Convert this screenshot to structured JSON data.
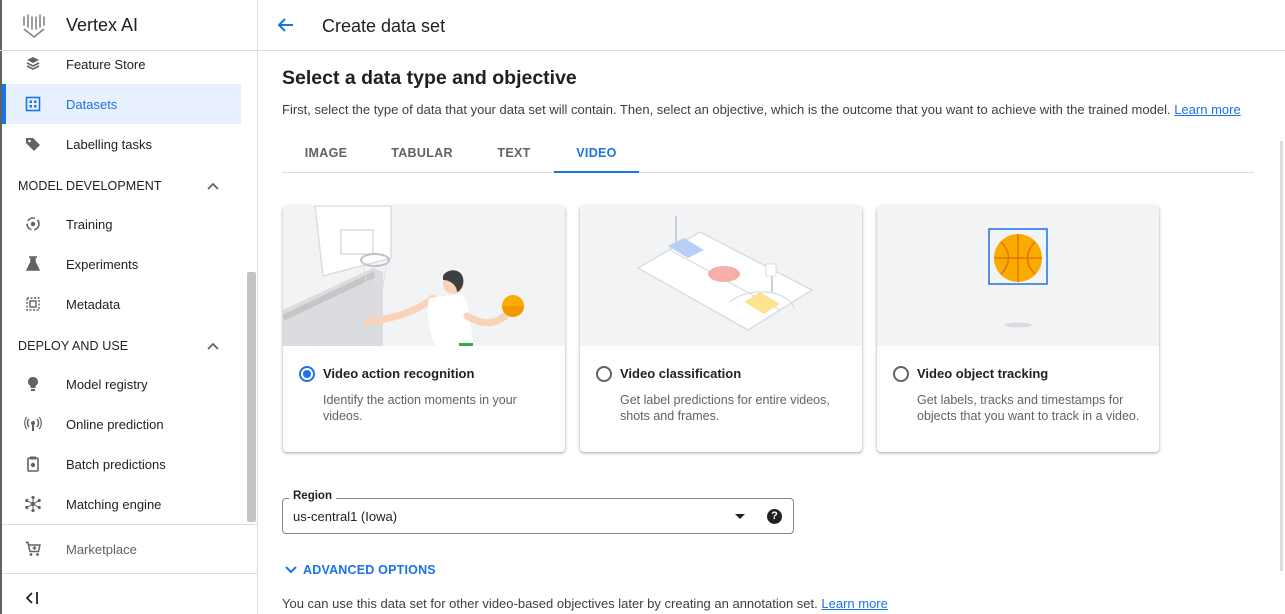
{
  "app": {
    "title": "Vertex AI"
  },
  "sidebar": {
    "items_top": [
      {
        "label": "Feature Store",
        "icon": "feature-store-icon"
      },
      {
        "label": "Datasets",
        "icon": "datasets-icon",
        "active": true
      },
      {
        "label": "Labelling tasks",
        "icon": "label-tag-icon"
      }
    ],
    "sections": [
      {
        "title": "MODEL DEVELOPMENT",
        "items": [
          {
            "label": "Training",
            "icon": "training-icon"
          },
          {
            "label": "Experiments",
            "icon": "experiments-icon"
          },
          {
            "label": "Metadata",
            "icon": "metadata-icon"
          }
        ]
      },
      {
        "title": "DEPLOY AND USE",
        "items": [
          {
            "label": "Model registry",
            "icon": "model-registry-icon"
          },
          {
            "label": "Online prediction",
            "icon": "online-prediction-icon"
          },
          {
            "label": "Batch predictions",
            "icon": "batch-predictions-icon"
          },
          {
            "label": "Matching engine",
            "icon": "matching-engine-icon"
          }
        ]
      }
    ],
    "marketplace": "Marketplace"
  },
  "header": {
    "title": "Create data set"
  },
  "main": {
    "heading": "Select a data type and objective",
    "intro": "First, select the type of data that your data set will contain. Then, select an objective, which is the outcome that you want to achieve with the trained model.",
    "learn_more": "Learn more",
    "tabs": [
      {
        "label": "IMAGE"
      },
      {
        "label": "TABULAR"
      },
      {
        "label": "TEXT"
      },
      {
        "label": "VIDEO",
        "active": true
      }
    ],
    "objectives": [
      {
        "title": "Video action recognition",
        "desc": "Identify the action moments in your videos.",
        "selected": true
      },
      {
        "title": "Video classification",
        "desc": "Get label predictions for entire videos, shots and frames.",
        "selected": false
      },
      {
        "title": "Video object tracking",
        "desc": "Get labels, tracks and timestamps for objects that you want to track in a video.",
        "selected": false
      }
    ],
    "region": {
      "label": "Region",
      "value": "us-central1 (Iowa)",
      "help": "?"
    },
    "advanced": "ADVANCED OPTIONS",
    "footer_text": "You can use this data set for other video-based objectives later by creating an annotation set.",
    "footer_link": "Learn more"
  },
  "colors": {
    "accent": "#1a73e8",
    "selected_bg": "#e8f0fe",
    "ball": "#f9ab00"
  }
}
